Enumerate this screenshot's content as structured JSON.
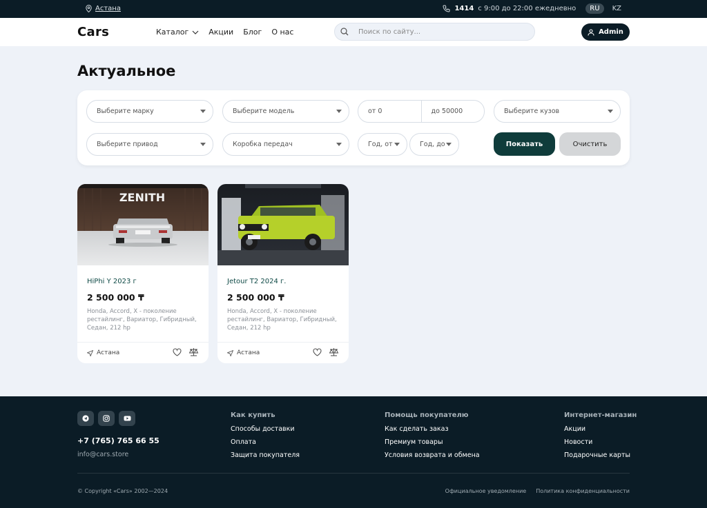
{
  "topbar": {
    "city": "Астана",
    "phone": "1414",
    "hours": "с 9:00 до 22:00 ежедневно",
    "languages": [
      "RU",
      "KZ"
    ]
  },
  "header": {
    "logo": "Cars",
    "nav": [
      "Каталог",
      "Акции",
      "Блог",
      "О нас"
    ],
    "search_placeholder": "Поиск по сайту...",
    "admin_label": "Admin"
  },
  "page": {
    "title": "Актуальное"
  },
  "filters": {
    "brand": "Выберите марку",
    "model": "Выберите модель",
    "price_from": "от 0",
    "price_to": "до 50000",
    "body": "Выберите кузов",
    "drive": "Выберите привод",
    "gearbox": "Коробка передач",
    "year_from": "Год, от",
    "year_to": "Год, до",
    "show_label": "Показать",
    "clear_label": "Очистить"
  },
  "cards": [
    {
      "name": "HiPhi Y 2023 г",
      "price": "2 500 000 ₸",
      "desc": "Honda, Accord, X - поколение рестайлинг, Вариатор, Гибридный, Седан, 212 hp",
      "location": "Астана",
      "photo_sign": "ZENITH"
    },
    {
      "name": "Jetour T2 2024 г.",
      "price": "2 500 000 ₸",
      "desc": "Honda, Accord, X - поколение рестайлинг, Вариатор, Гибридный, Седан, 212 hp",
      "location": "Астана"
    }
  ],
  "footer": {
    "phone": "+7 (765) 765 66 55",
    "email": "info@cars.store",
    "columns": [
      {
        "head": "Как купить",
        "links": [
          "Способы доставки",
          "Оплата",
          "Защита покупателя"
        ]
      },
      {
        "head": "Помощь покупателю",
        "links": [
          "Как сделать заказ",
          "Премиум товары",
          "Условия возврата и обмена"
        ]
      },
      {
        "head": "Интернет-магазин",
        "links": [
          "Акции",
          "Новости",
          "Подарочные карты"
        ]
      }
    ],
    "copyright": "© Copyright «Cars» 2002—2024",
    "legal": [
      "Официальное уведомление",
      "Политика конфиденциальности"
    ]
  },
  "colors": {
    "dark": "#0b1c26",
    "accent": "#0f3c3b",
    "background": "#eef2f8"
  }
}
